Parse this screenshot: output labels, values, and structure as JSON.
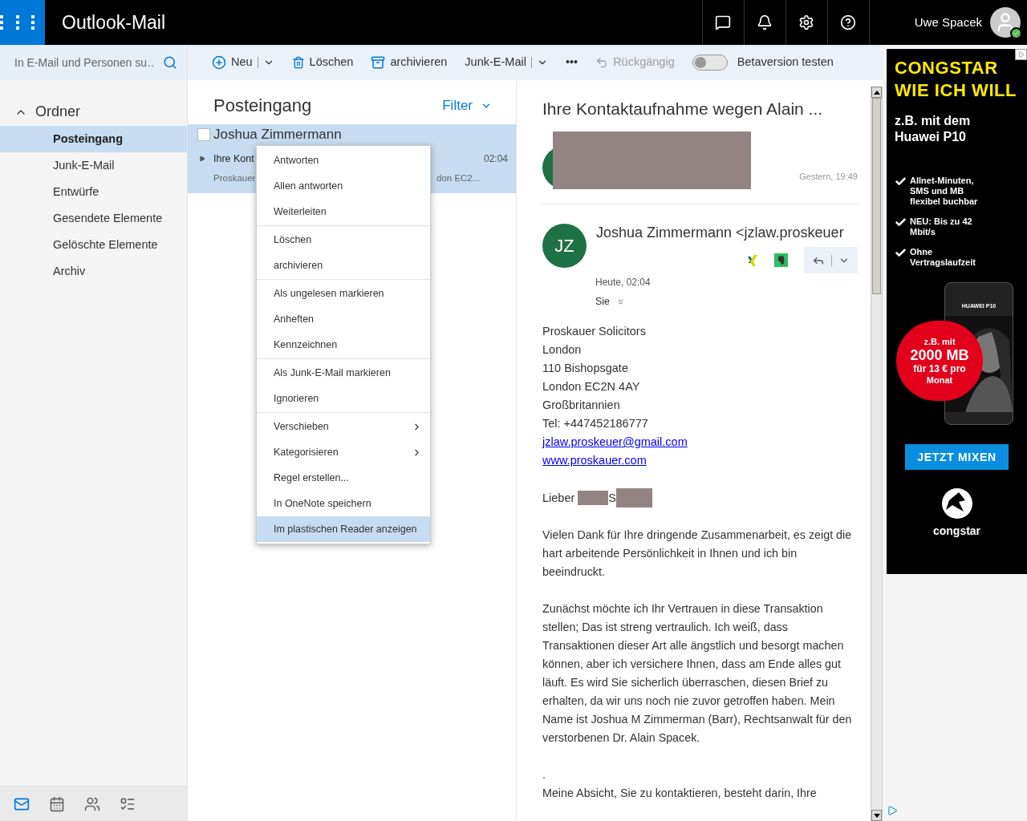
{
  "header": {
    "app_title": "Outlook-Mail",
    "user_name": "Uwe Spacek",
    "user_online": true
  },
  "search": {
    "placeholder": "In E-Mail und Personen su…"
  },
  "toolbar": [
    {
      "kind": "new",
      "label": "Neu",
      "disabled": false
    },
    {
      "kind": "delete",
      "label": "Löschen",
      "disabled": false
    },
    {
      "kind": "archive",
      "label": "archivieren",
      "disabled": false
    },
    {
      "kind": "junk",
      "label": "Junk-E-Mail",
      "disabled": false
    },
    {
      "kind": "more",
      "label": "•••",
      "disabled": false
    },
    {
      "kind": "undo",
      "label": "Rückgängig",
      "disabled": true
    }
  ],
  "beta_toggle": {
    "label": "Betaversion testen",
    "on": false
  },
  "folders": {
    "title": "Ordner",
    "expanded": true,
    "items": [
      {
        "label": "Posteingang",
        "selected": true
      },
      {
        "label": "Junk-E-Mail",
        "selected": false
      },
      {
        "label": "Entwürfe",
        "selected": false
      },
      {
        "label": "Gesendete Elemente",
        "selected": false
      },
      {
        "label": "Gelöschte Elemente",
        "selected": false
      },
      {
        "label": "Archiv",
        "selected": false
      }
    ]
  },
  "bottom_nav": [
    {
      "kind": "mail",
      "selected": true
    },
    {
      "kind": "calendar",
      "selected": false
    },
    {
      "kind": "people",
      "selected": false
    },
    {
      "kind": "tasks",
      "selected": false
    }
  ],
  "message_list": {
    "title": "Posteingang",
    "filter": "Filter",
    "messages": [
      {
        "sender": "Joshua Zimmermann",
        "subject": "Ihre Kont",
        "time": "02:04",
        "preview_start": "Proskauer",
        "preview_end": "don EC2...",
        "selected": true,
        "checked": false
      }
    ]
  },
  "context_menu": [
    {
      "label": "Antworten",
      "kind": "item",
      "divider_before": false,
      "selected": false
    },
    {
      "label": "Allen antworten",
      "kind": "item",
      "divider_before": false,
      "selected": false
    },
    {
      "label": "Weiterleiten",
      "kind": "item",
      "divider_before": false,
      "selected": false
    },
    {
      "label": "Löschen",
      "kind": "item",
      "divider_before": true,
      "selected": false
    },
    {
      "label": "archivieren",
      "kind": "item",
      "divider_before": false,
      "selected": false
    },
    {
      "label": "Als ungelesen markieren",
      "kind": "item",
      "divider_before": true,
      "selected": false
    },
    {
      "label": "Anheften",
      "kind": "item",
      "divider_before": false,
      "selected": false
    },
    {
      "label": "Kennzeichnen",
      "kind": "item",
      "divider_before": false,
      "selected": false
    },
    {
      "label": "Als Junk-E-Mail markieren",
      "kind": "item",
      "divider_before": true,
      "selected": false
    },
    {
      "label": "Ignorieren",
      "kind": "item",
      "divider_before": false,
      "selected": false
    },
    {
      "label": "Verschieben",
      "kind": "submenu",
      "divider_before": true,
      "selected": false
    },
    {
      "label": "Kategorisieren",
      "kind": "submenu",
      "divider_before": false,
      "selected": false
    },
    {
      "label": "Regel erstellen...",
      "kind": "item",
      "divider_before": false,
      "selected": false
    },
    {
      "label": "In OneNote speichern",
      "kind": "item",
      "divider_before": false,
      "selected": false
    },
    {
      "label": "Im plastischen Reader anzeigen",
      "kind": "item",
      "divider_before": false,
      "selected": true
    }
  ],
  "reading_pane": {
    "subject": "Ihre Kontaktaufnahme wegen Alain ...",
    "earlier_message": {
      "time": "Gestern, 19:49"
    },
    "message": {
      "initials": "JZ",
      "sender": "Joshua Zimmermann <jzlaw.proskeuer",
      "time": "Heute, 02:04",
      "recipient": "Sie",
      "body": [
        {
          "kind": "line",
          "text": "Proskauer Solicitors"
        },
        {
          "kind": "line",
          "text": "London"
        },
        {
          "kind": "line",
          "text": "110 Bishopsgate"
        },
        {
          "kind": "line",
          "text": "London EC2N 4AY"
        },
        {
          "kind": "line",
          "text": "Großbritannien"
        },
        {
          "kind": "line",
          "text": "Tel: +447452186777"
        },
        {
          "kind": "link",
          "text": "jzlaw.proskeuer@gmail.com"
        },
        {
          "kind": "link",
          "text": "www.proskauer.com"
        },
        {
          "kind": "greeting",
          "text": "Lieber",
          "middle": "S"
        },
        {
          "kind": "paragraph",
          "text": "Vielen Dank für Ihre dringende Zusammenarbeit, es zeigt die hart arbeitende Persönlichkeit in Ihnen und ich bin beeindruckt."
        },
        {
          "kind": "paragraph",
          "text": "Zunächst möchte ich Ihr Vertrauen in diese Transaktion stellen; Das ist streng vertraulich. Ich weiß, dass Transaktionen dieser Art alle ängstlich und besorgt machen können, aber ich versichere Ihnen, dass am Ende alles gut läuft. Es wird Sie sicherlich überraschen, diesen Brief zu erhalten, da wir uns noch nie zuvor getroffen haben. Mein Name ist Joshua M Zimmerman (Barr), Rechtsanwalt für den verstorbenen Dr. Alain Spacek."
        },
        {
          "kind": "line",
          "text": "."
        },
        {
          "kind": "paragraph",
          "text": "Meine Absicht, Sie zu kontaktieren, besteht darin, Ihre"
        }
      ]
    }
  },
  "ad": {
    "headline": [
      "CONGSTAR",
      "WIE ICH WILL"
    ],
    "subline": "z.B. mit dem Huawei P10",
    "features": [
      "Allnet-Minuten, SMS und MB flexibel buchbar",
      "NEU: Bis zu 42 Mbit/s",
      "Ohne Vertragslaufzeit"
    ],
    "phone_brand": "HUAWEI P10",
    "badge": [
      "z.B. mit",
      "2000 MB",
      "für 13 € pro",
      "Monat"
    ],
    "button": "JETZT MIXEN",
    "brand": "congstar"
  }
}
